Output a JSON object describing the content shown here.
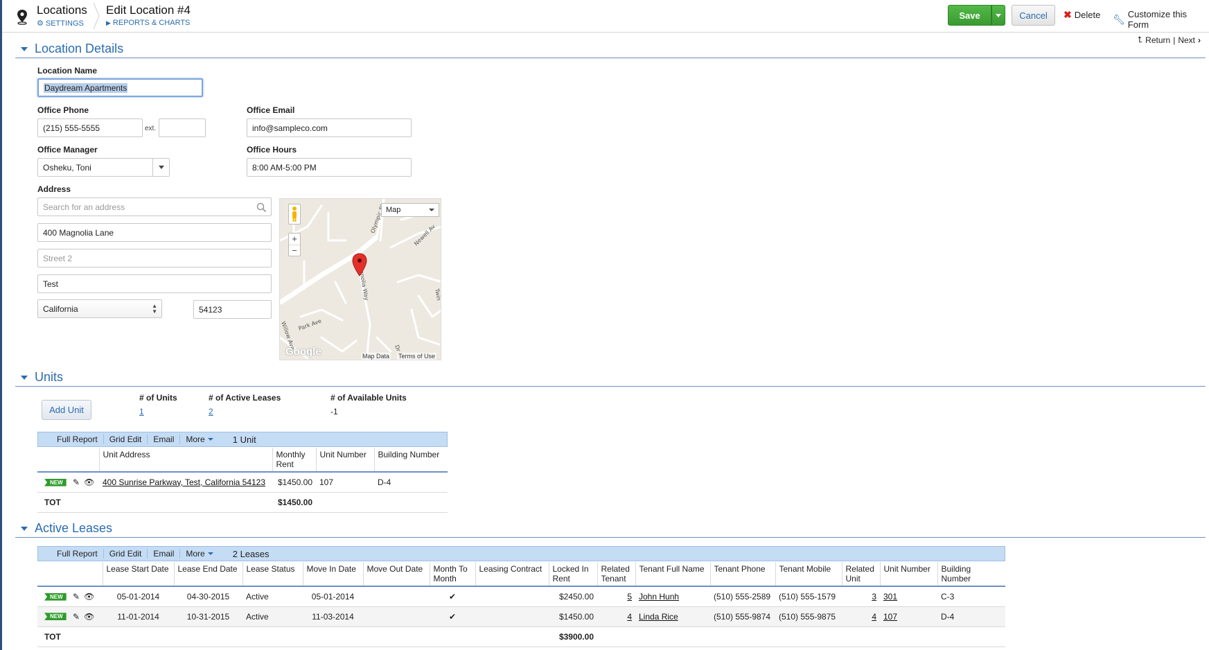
{
  "header": {
    "title": "Locations",
    "settings_link": "SETTINGS",
    "page_title": "Edit Location #4",
    "reports_link": "REPORTS & CHARTS",
    "save_label": "Save",
    "cancel_label": "Cancel",
    "delete_label": "Delete",
    "customize_label": "Customize this Form",
    "return_label": "Return",
    "next_label": "Next"
  },
  "location_details": {
    "section_title": "Location Details",
    "location_name_label": "Location Name",
    "location_name_value": "Daydream Apartments",
    "office_phone_label": "Office Phone",
    "office_phone_value": "(215) 555-5555",
    "ext_label": "ext.",
    "ext_value": "",
    "office_email_label": "Office Email",
    "office_email_value": "info@sampleco.com",
    "office_manager_label": "Office Manager",
    "office_manager_value": "Osheku, Toni",
    "office_hours_label": "Office Hours",
    "office_hours_value": "8:00 AM-5:00 PM",
    "address_label": "Address",
    "address_search_placeholder": "Search for an address",
    "street1_value": "400 Magnolia Lane",
    "street2_placeholder": "Street 2",
    "city_value": "Test",
    "state_value": "California",
    "zip_value": "54123"
  },
  "map": {
    "type_select": "Map",
    "street_labels": [
      "Olympic Bl",
      "Newell Av",
      "Magnolia Way",
      "Park Ave",
      "Willow Ave",
      "Dr",
      "Twin"
    ],
    "attribution": "Map Data",
    "terms": "Terms of Use",
    "logo": "Google",
    "zoom_in": "+",
    "zoom_out": "−"
  },
  "units": {
    "section_title": "Units",
    "add_button": "Add  Unit",
    "stats": [
      {
        "label": "# of Units",
        "value": "1"
      },
      {
        "label": "# of Active Leases",
        "value": "2"
      },
      {
        "label": "# of Available Units",
        "value": "-1"
      }
    ],
    "toolbar": [
      "Full Report",
      "Grid Edit",
      "Email",
      "More"
    ],
    "count_label": "1 Unit",
    "columns": [
      "Unit Address",
      "Monthly Rent",
      "Unit Number",
      "Building Number"
    ],
    "rows": [
      {
        "tag": "NEW",
        "address": "400 Sunrise Parkway, Test, California 54123",
        "rent": "$1450.00",
        "unit_number": "107",
        "building": "D-4"
      }
    ],
    "total_label": "TOT",
    "total_rent": "$1450.00"
  },
  "leases": {
    "section_title": "Active Leases",
    "toolbar": [
      "Full Report",
      "Grid Edit",
      "Email",
      "More"
    ],
    "count_label": "2 Leases",
    "columns": [
      "Lease Start Date",
      "Lease End Date",
      "Lease Status",
      "Move In Date",
      "Move Out Date",
      "Month To Month",
      "Leasing Contract",
      "Locked In Rent",
      "Related Tenant",
      "Tenant Full Name",
      "Tenant Phone",
      "Tenant Mobile",
      "Related Unit",
      "Unit Number",
      "Building Number"
    ],
    "rows": [
      {
        "tag": "NEW",
        "start": "05-01-2014",
        "end": "04-30-2015",
        "status": "Active",
        "move_in": "05-01-2014",
        "move_out": "",
        "mtm": "✔",
        "contract": "",
        "rent": "$2450.00",
        "tenant_id": "5",
        "tenant_name": "John Hunh",
        "phone": "(510) 555-2589",
        "mobile": "(510) 555-1579",
        "unit_id": "3",
        "unit_number": "301",
        "building": "C-3"
      },
      {
        "tag": "NEW",
        "start": "11-01-2014",
        "end": "10-31-2015",
        "status": "Active",
        "move_in": "11-03-2014",
        "move_out": "",
        "mtm": "✔",
        "contract": "",
        "rent": "$1450.00",
        "tenant_id": "4",
        "tenant_name": "Linda Rice",
        "phone": "(510) 555-9874",
        "mobile": "(510) 555-9875",
        "unit_id": "4",
        "unit_number": "107",
        "building": "D-4"
      }
    ],
    "total_label": "TOT",
    "total_rent": "$3900.00"
  },
  "colors": {
    "accent": "#2a6cb0",
    "save": "#3a9a31",
    "toolbar_bg": "#c5dcf5",
    "delete": "#d9201f",
    "new_tag": "#2e9c2a"
  },
  "icons": {
    "module": "map-pin-icon",
    "settings": "gear-icon",
    "reports": "triangle-right-icon",
    "delete": "x-icon",
    "customize": "wrench-icon",
    "search": "search-icon",
    "edit": "pencil-icon",
    "view": "eye-icon"
  }
}
